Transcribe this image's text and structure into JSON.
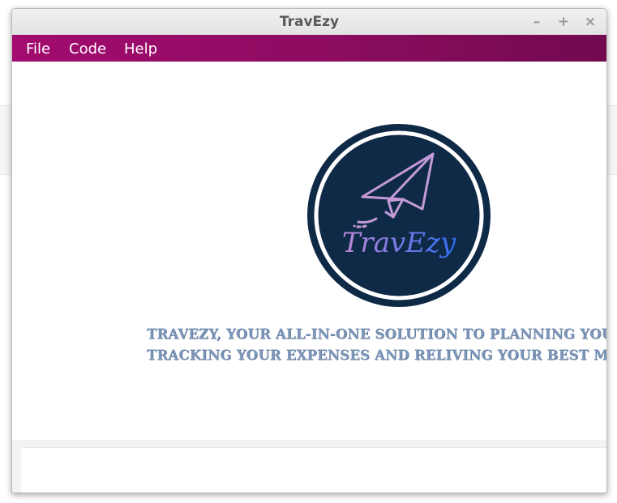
{
  "window": {
    "title": "TravEzy",
    "controls": {
      "minimize": "–",
      "maximize": "+",
      "close": "×"
    }
  },
  "menubar": {
    "items": [
      {
        "label": "File"
      },
      {
        "label": "Code"
      },
      {
        "label": "Help"
      }
    ]
  },
  "main": {
    "logo": {
      "text": "TravEzy",
      "icon": "paper-plane-icon",
      "colors": {
        "circle": "#0f2a47",
        "ring": "#ffffff",
        "plane": "#c49ad8",
        "text_start": "#c08ad8",
        "text_end": "#2f6cf0"
      }
    },
    "tagline": {
      "line1": "TRAVEZY, YOUR ALL-IN-ONE SOLUTION TO PLANNING YOUR T",
      "line2": "TRACKING YOUR EXPENSES AND RELIVING YOUR BEST MOM"
    }
  },
  "theme": {
    "menubar_accent": "#a20b6f",
    "tagline_color": "#7b95b8"
  }
}
